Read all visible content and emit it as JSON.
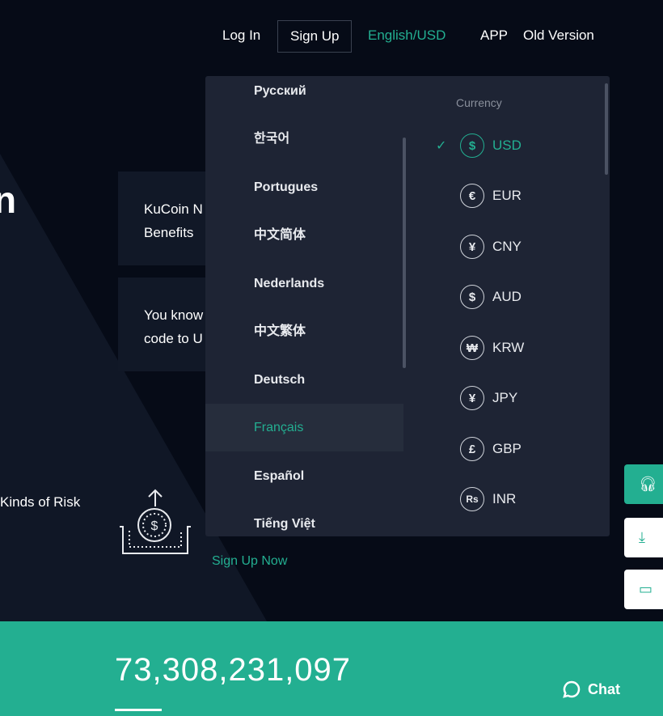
{
  "nav": {
    "login": "Log In",
    "signup": "Sign Up",
    "lang_currency": "English/USD",
    "app": "APP",
    "old_version": "Old Version"
  },
  "hero": {
    "title_fragment": "n",
    "risk_fragment": "Kinds of Risk",
    "sign_up_now": "Sign Up Now"
  },
  "cards": [
    {
      "line1": "KuCoin N",
      "line2": "Benefits"
    },
    {
      "line1": "You know",
      "line2": "code to U"
    }
  ],
  "languages": [
    "Русский",
    "한국어",
    "Portugues",
    "中文简体",
    "Nederlands",
    "中文繁体",
    "Deutsch",
    "Français",
    "Español",
    "Tiếng Việt"
  ],
  "selected_language": "Français",
  "currency_header": "Currency",
  "currencies": [
    {
      "code": "USD",
      "symbol": "$",
      "selected": true
    },
    {
      "code": "EUR",
      "symbol": "€"
    },
    {
      "code": "CNY",
      "symbol": "¥"
    },
    {
      "code": "AUD",
      "symbol": "$"
    },
    {
      "code": "KRW",
      "symbol": "₩"
    },
    {
      "code": "JPY",
      "symbol": "¥"
    },
    {
      "code": "GBP",
      "symbol": "£"
    },
    {
      "code": "INR",
      "symbol": "Rs"
    }
  ],
  "stats": {
    "value": "73,308,231,097"
  },
  "chat": {
    "label": "Chat"
  },
  "colors": {
    "accent": "#23af91",
    "dropdown_bg": "#1e2434",
    "background": "#060b17"
  }
}
